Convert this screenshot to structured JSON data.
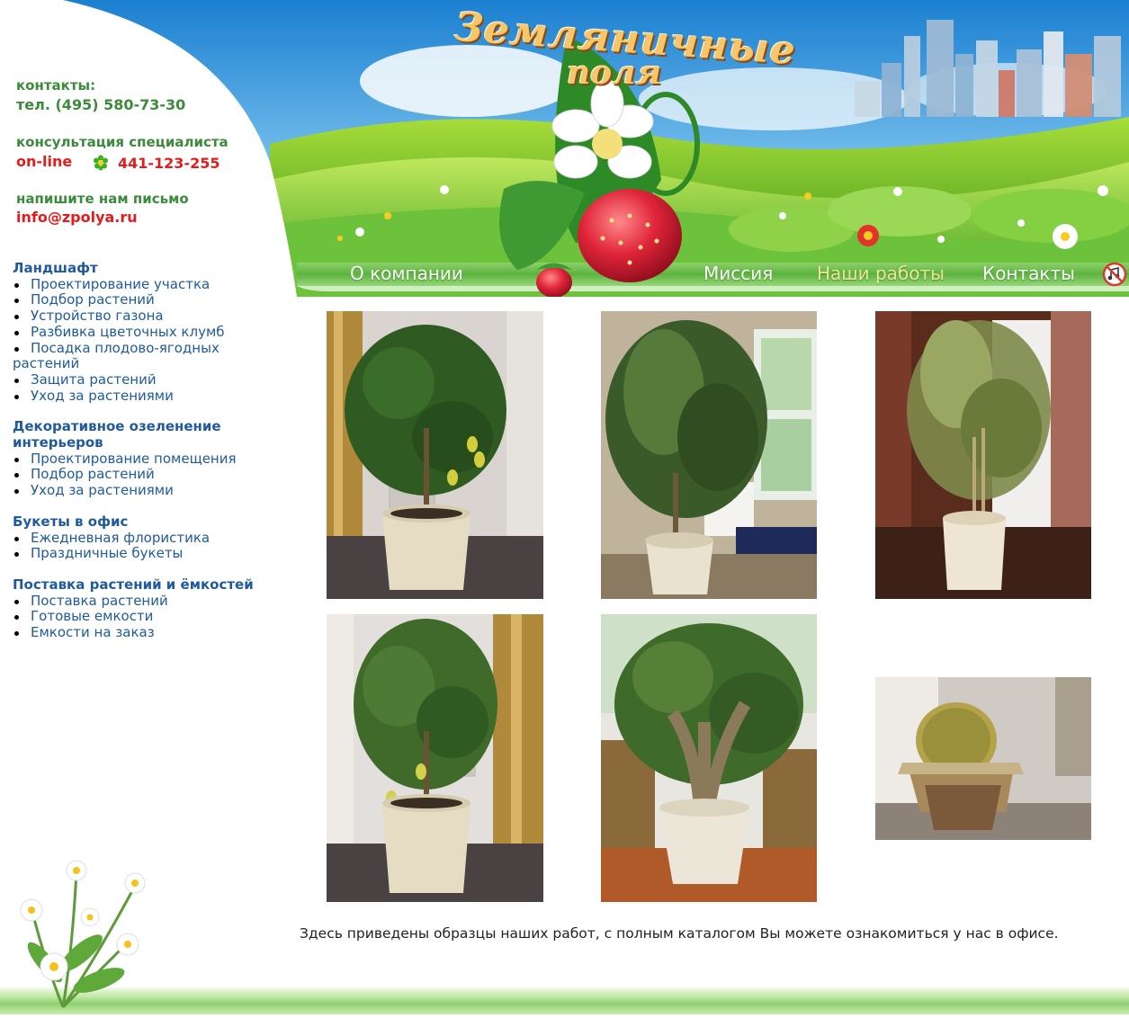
{
  "site": {
    "logo_line1": "Земляничные",
    "logo_line2": "поля"
  },
  "nav": {
    "items": [
      {
        "label": "О компании",
        "active": false
      },
      {
        "label": "Миссия",
        "active": false
      },
      {
        "label": "Наши работы",
        "active": true
      },
      {
        "label": "Контакты",
        "active": false
      }
    ],
    "sound_icon": "no-sound-icon"
  },
  "contacts": {
    "contacts_label": "контакты:",
    "phone": "тел. (495) 580-73-30",
    "consult_label": "консультация специалиста",
    "online_label": "on-line",
    "icq_icon": "icq-flower-icon",
    "icq_number": "441-123-255",
    "mail_label": "напишите нам письмо",
    "email": "info@zpolya.ru"
  },
  "menu": [
    {
      "title": "Ландшафт",
      "items": [
        "Проектирование участка",
        "Подбор растений",
        "Устройство газона",
        "Разбивка цветочных клумб",
        "Посадка плодово-ягодных растений",
        "Защита растений",
        "Уход за растениями"
      ]
    },
    {
      "title": "Декоративное озеленение интерьеров",
      "items": [
        "Проектирование помещения",
        "Подбор растений",
        "Уход за растениями"
      ]
    },
    {
      "title": "Букеты в офис",
      "items": [
        "Ежедневная флористика",
        "Праздничные букеты"
      ]
    },
    {
      "title": "Поставка растений и ёмкостей",
      "items": [
        "Поставка растений",
        "Готовые емкости",
        "Емкости на заказ"
      ]
    }
  ],
  "gallery": {
    "photos": [
      "lemon-tree-photo",
      "palm-plant-photo",
      "bamboo-plant-photo",
      "lemon-tree-photo-2",
      "jade-tree-photo",
      "cactus-photo"
    ],
    "caption": "Здесь приведены образцы наших работ, с полным каталогом Вы можете ознакомиться у нас в офисе."
  },
  "colors": {
    "menu_blue": "#1f5a9e",
    "contact_green": "#3c8a3c",
    "contact_red": "#e61b1b",
    "nav_active": "#f1e39a"
  }
}
